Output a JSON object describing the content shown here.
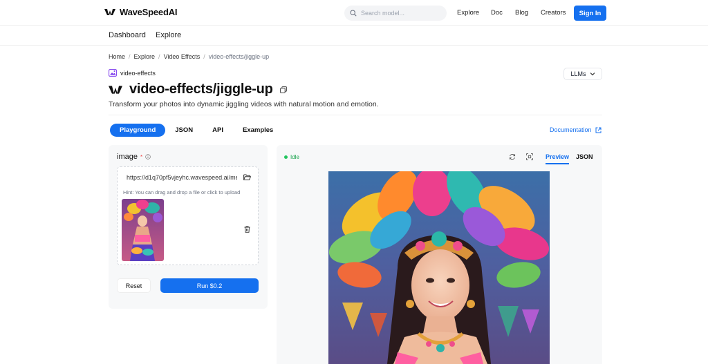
{
  "header": {
    "brand": "WaveSpeedAI",
    "search_placeholder": "Search model...",
    "nav": [
      "Explore",
      "Doc",
      "Blog",
      "Creators"
    ],
    "signin_label": "Sign In"
  },
  "subnav": [
    "Dashboard",
    "Explore"
  ],
  "breadcrumb": [
    "Home",
    "Explore",
    "Video Effects",
    "video-effects/jiggle-up"
  ],
  "model": {
    "category": "video-effects",
    "title": "video-effects/jiggle-up",
    "description": "Transform your photos into dynamic jiggling videos with natural motion and emotion.",
    "llms_label": "LLMs"
  },
  "tabs": [
    "Playground",
    "JSON",
    "API",
    "Examples"
  ],
  "documentation_label": "Documentation",
  "input": {
    "label": "image",
    "required_mark": "*",
    "url_value": "https://d1q70pf5vjeyhc.wavespeed.ai/media/images/example.jpg",
    "hint": "Hint: You can drag and drop a file or click to upload",
    "reset_label": "Reset",
    "run_label": "Run $0.2"
  },
  "output": {
    "status": "Idle",
    "tabs": [
      "Preview",
      "JSON"
    ]
  },
  "colors": {
    "accent": "#1570ef",
    "status_green": "#22c55e"
  }
}
